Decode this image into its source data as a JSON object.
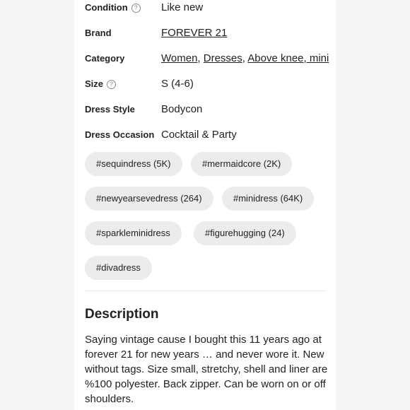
{
  "details": {
    "condition": {
      "label": "Condition",
      "value": "Like new",
      "help": "?"
    },
    "brand": {
      "label": "Brand",
      "value": "FOREVER 21"
    },
    "category": {
      "label": "Category",
      "values": [
        "Women",
        "Dresses",
        "Above knee, mini"
      ]
    },
    "size": {
      "label": "Size",
      "value": "S (4-6)",
      "help": "?"
    },
    "dress_style": {
      "label": "Dress Style",
      "value": "Bodycon"
    },
    "dress_occasion": {
      "label": "Dress Occasion",
      "value": "Cocktail & Party"
    }
  },
  "tags": [
    "#sequindress (5K)",
    "#mermaidcore (2K)",
    "#newyearsevedress (264)",
    "#minidress (64K)",
    "#sparkleminidress",
    "#figurehugging (24)",
    "#divadress"
  ],
  "description": {
    "title": "Description",
    "body": "Saying vintage cause I bought this 11 years ago at forever 21 for new years … and never wore it. New without tags. Size small, stretchy, shell and liner are %100 polyester. Back zipper. Can be worn on or off shoulders."
  },
  "icons": {
    "help": "question-circle-icon"
  },
  "colors": {
    "background": "#f5f5f6",
    "card": "#ffffff",
    "tag_bg": "#ececee",
    "text": "#222222"
  }
}
